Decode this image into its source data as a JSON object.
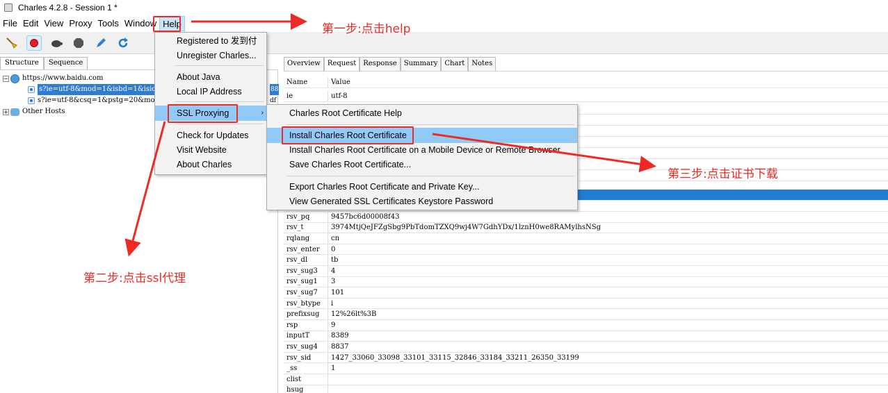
{
  "window": {
    "title": "Charles 4.2.8 - Session 1 *"
  },
  "menubar": {
    "items": [
      "File",
      "Edit",
      "View",
      "Proxy",
      "Tools",
      "Window",
      "Help"
    ]
  },
  "left_tabs": [
    "Structure",
    "Sequence"
  ],
  "tree": {
    "host": "https://www.baidu.com",
    "requests": [
      "s?ie=utf-8&mod=1&isbd=1&isid",
      "s?ie=utf-8&csq=1&pstg=20&mod"
    ],
    "other_hosts": "Other Hosts",
    "cut_suffixes": [
      "88",
      "df"
    ]
  },
  "right_tabs": [
    "Overview",
    "Request",
    "Response",
    "Summary",
    "Chart",
    "Notes"
  ],
  "table": {
    "header": {
      "name": "Name",
      "value": "Value"
    },
    "top_rows": [
      {
        "name": "ie",
        "value": "utf-8"
      }
    ],
    "rows": [
      {
        "name": "rsv_pq",
        "value": "9457bc6d00008f43"
      },
      {
        "name": "rsv_t",
        "value": "3974MtjQeJFZgSbg9PbTdomTZXQ9wj4W7GdhYDx/1lznH0we8RAMylhsNSg"
      },
      {
        "name": "rqlang",
        "value": "cn"
      },
      {
        "name": "rsv_enter",
        "value": "0"
      },
      {
        "name": "rsv_dl",
        "value": "tb"
      },
      {
        "name": "rsv_sug3",
        "value": "4"
      },
      {
        "name": "rsv_sug1",
        "value": "3"
      },
      {
        "name": "rsv_sug7",
        "value": "101"
      },
      {
        "name": "rsv_btype",
        "value": "i"
      },
      {
        "name": "prefixsug",
        "value": "12%26lt%3B"
      },
      {
        "name": "rsp",
        "value": "9"
      },
      {
        "name": "inputT",
        "value": "8389"
      },
      {
        "name": "rsv_sug4",
        "value": "8837"
      },
      {
        "name": "rsv_sid",
        "value": "1427_33060_33098_33101_33115_32846_33184_33211_26350_33199"
      },
      {
        "name": "_ss",
        "value": "1"
      },
      {
        "name": "clist",
        "value": ""
      },
      {
        "name": "hsug",
        "value": ""
      }
    ]
  },
  "help_menu": {
    "registered": "Registered to 发到付",
    "unregister": "Unregister Charles...",
    "about_java": "About Java",
    "local_ip": "Local IP Address",
    "ssl_proxying": "SSL Proxying",
    "submenu_arrow": "›",
    "check_updates": "Check for Updates",
    "visit_website": "Visit Website",
    "about_charles": "About Charles"
  },
  "ssl_menu": {
    "root_help": "Charles Root Certificate Help",
    "install_root": "Install Charles Root Certificate",
    "install_mobile": "Install Charles Root Certificate on a Mobile Device or Remote Browser",
    "save_root": "Save Charles Root Certificate...",
    "export_root": "Export Charles Root Certificate and Private Key...",
    "view_keystore": "View Generated SSL Certificates Keystore Password"
  },
  "annotations": {
    "step1": "第一步:点击help",
    "step2": "第二步:点击ssl代理",
    "step3": "第三步:点击证书下载"
  },
  "colors": {
    "annotation_red": "#ee2a24",
    "selection_blue": "#2f7bd6",
    "menu_highlight": "#91c9f7",
    "record_red": "#e21f26"
  },
  "toolbar_icons": [
    "broom-icon",
    "record-icon",
    "turtle-icon",
    "stop-icon",
    "pen-icon",
    "refresh-icon"
  ]
}
